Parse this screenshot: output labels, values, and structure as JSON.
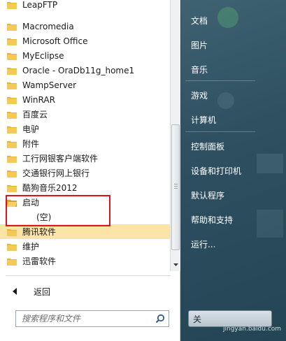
{
  "programs": {
    "items": [
      {
        "label": "LeapFTP"
      },
      {
        "label": "Macromedia"
      },
      {
        "label": "Microsoft Office"
      },
      {
        "label": "MyEclipse"
      },
      {
        "label": "Oracle - OraDb11g_home1"
      },
      {
        "label": "WampServer"
      },
      {
        "label": "WinRAR"
      },
      {
        "label": "百度云"
      },
      {
        "label": "电驴"
      },
      {
        "label": "附件"
      },
      {
        "label": "工行网银客户端软件"
      },
      {
        "label": "交通银行网上银行"
      },
      {
        "label": "酷狗音乐2012"
      },
      {
        "label": "启动"
      },
      {
        "label": "腾讯软件"
      },
      {
        "label": "维护"
      },
      {
        "label": "迅雷软件"
      }
    ],
    "startup_sub": "(空)"
  },
  "back_label": "返回",
  "search": {
    "placeholder": "搜索程序和文件"
  },
  "right_pane": {
    "items": [
      "文档",
      "图片",
      "音乐",
      "游戏",
      "计算机",
      "控制面板",
      "设备和打印机",
      "默认程序",
      "帮助和支持",
      "运行..."
    ],
    "shutdown_label": "关",
    "watermark": "jingyan.baidu.com"
  },
  "colors": {
    "selected_bg": "#fbe4a6",
    "highlight_border": "#e0131b",
    "folder": "#e8b43a"
  }
}
